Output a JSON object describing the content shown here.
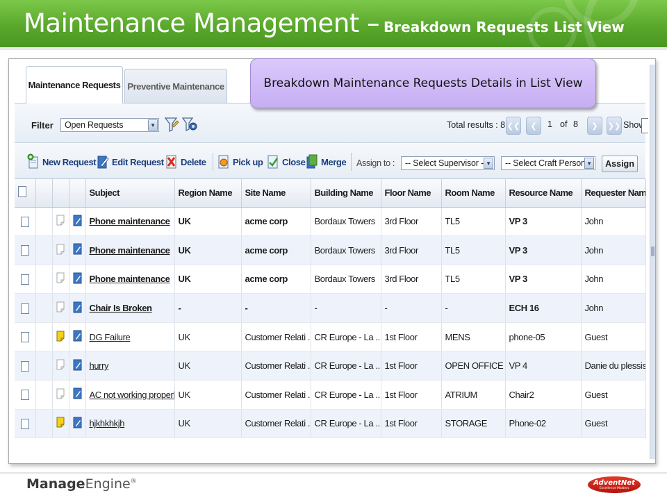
{
  "slide": {
    "title": "Maintenance Management –",
    "subtitle": "Breakdown Requests List View",
    "callout": "Breakdown Maintenance Requests Details in List View"
  },
  "tabs": [
    {
      "label": "Maintenance Requests",
      "active": true
    },
    {
      "label": "Preventive Maintenance",
      "active": false
    }
  ],
  "filter": {
    "label": "Filter",
    "selected": "Open Requests"
  },
  "pagination": {
    "total_results": "Total results : 8",
    "current": "1",
    "of": "of",
    "total_pages": "8",
    "show": "Show"
  },
  "toolbar": {
    "new_request": "New Request",
    "edit_request": "Edit Request",
    "delete": "Delete",
    "pick_up": "Pick up",
    "close": "Close",
    "merge": "Merge",
    "assign_to": "Assign to :",
    "supervisor_select": "-- Select Supervisor --",
    "craft_select": "-- Select Craft Person",
    "assign_button": "Assign"
  },
  "table": {
    "columns": [
      "Subject",
      "Region Name",
      "Site Name",
      "Building Name",
      "Floor Name",
      "Room Name",
      "Resource Name",
      "Requester Name"
    ],
    "rows": [
      {
        "subject": "Phone maintenance",
        "region": "UK",
        "site": "acme corp",
        "building": "Bordaux Towers",
        "floor": "3rd Floor",
        "room": "TL5",
        "resource": "VP 3",
        "requester": "John",
        "bold": true,
        "flagged": false
      },
      {
        "subject": "Phone maintenance",
        "region": "UK",
        "site": "acme corp",
        "building": "Bordaux Towers",
        "floor": "3rd Floor",
        "room": "TL5",
        "resource": "VP 3",
        "requester": "John",
        "bold": true,
        "flagged": false
      },
      {
        "subject": "Phone maintenance",
        "region": "UK",
        "site": "acme corp",
        "building": "Bordaux Towers",
        "floor": "3rd Floor",
        "room": "TL5",
        "resource": "VP 3",
        "requester": "John",
        "bold": true,
        "flagged": false
      },
      {
        "subject": "Chair Is Broken",
        "region": "-",
        "site": "-",
        "building": "-",
        "floor": "-",
        "room": "-",
        "resource": "ECH 16",
        "requester": "John",
        "bold": true,
        "flagged": false
      },
      {
        "subject": "DG Failure",
        "region": "UK",
        "site": "Customer Relati ...",
        "building": "CR Europe - La ...",
        "floor": "1st Floor",
        "room": "MENS",
        "resource": "phone-05",
        "requester": "Guest",
        "bold": false,
        "flagged": true
      },
      {
        "subject": "hurry",
        "region": "UK",
        "site": "Customer Relati ...",
        "building": "CR Europe - La ...",
        "floor": "1st Floor",
        "room": "OPEN OFFICE",
        "resource": "VP 4",
        "requester": "Danie du plessis",
        "bold": false,
        "flagged": false
      },
      {
        "subject": "AC not working properly",
        "region": "UK",
        "site": "Customer Relati ...",
        "building": "CR Europe - La ...",
        "floor": "1st Floor",
        "room": "ATRIUM",
        "resource": "Chair2",
        "requester": "Guest",
        "bold": false,
        "flagged": false
      },
      {
        "subject": "hjkhkhkjh",
        "region": "UK",
        "site": "Customer Relati ...",
        "building": "CR Europe - La ...",
        "floor": "1st Floor",
        "room": "STORAGE",
        "resource": "Phone-02",
        "requester": "Guest",
        "bold": false,
        "flagged": true
      }
    ]
  },
  "footer": {
    "brand_a": "Manage",
    "brand_b": "Engine",
    "brand_mark": "®",
    "partner_name": "AdventNet",
    "partner_tagline": "Excellence Matters"
  },
  "colors": {
    "header_green": "#5aa82c",
    "link_blue": "#1a3d7a",
    "callout_purple": "#c6aef4",
    "row_alt": "#eef3fb",
    "flag_yellow": "#f4d21a"
  }
}
